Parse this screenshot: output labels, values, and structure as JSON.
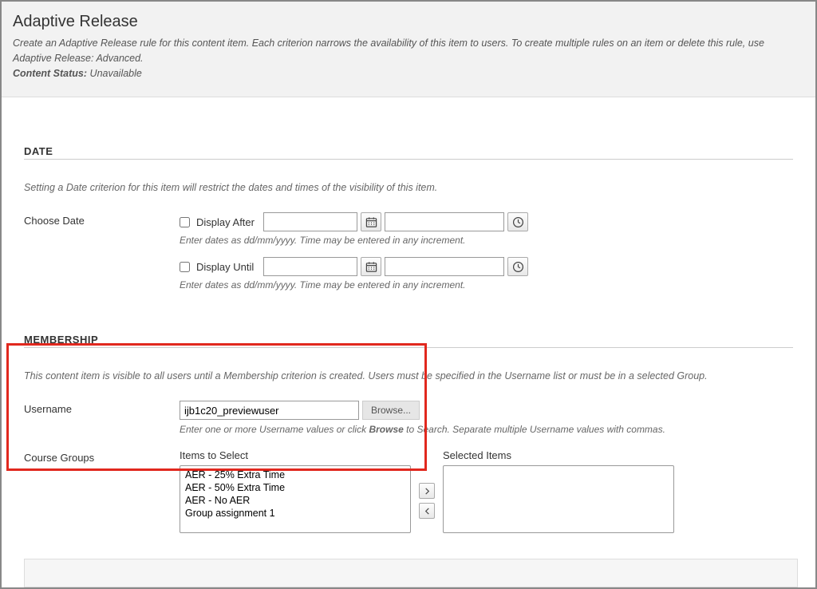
{
  "header": {
    "title": "Adaptive Release",
    "description": "Create an Adaptive Release rule for this content item. Each criterion narrows the availability of this item to users. To create multiple rules on an item or delete this rule, use Adaptive Release: Advanced.",
    "status_label": "Content Status:",
    "status_value": "Unavailable"
  },
  "date_section": {
    "heading": "DATE",
    "help": "Setting a Date criterion for this item will restrict the dates and times of the visibility of this item.",
    "label": "Choose Date",
    "after_label": "Display After",
    "until_label": "Display Until",
    "after_date": "",
    "after_time": "",
    "until_date": "",
    "until_time": "",
    "enter_hint": "Enter dates as dd/mm/yyyy. Time may be entered in any increment."
  },
  "membership_section": {
    "heading": "MEMBERSHIP",
    "help": "This content item is visible to all users until a Membership criterion is created. Users must be specified in the Username list or must be in a selected Group.",
    "username_label": "Username",
    "username_value": "ijb1c20_previewuser",
    "browse_label": "Browse...",
    "username_hint_pre": "Enter one or more Username values or click ",
    "username_hint_bold": "Browse",
    "username_hint_post": " to Search. Separate multiple Username values with commas.",
    "groups_label": "Course Groups",
    "items_to_select_label": "Items to Select",
    "selected_items_label": "Selected Items",
    "available_groups": [
      "AER - 25% Extra Time",
      "AER - 50% Extra Time",
      "AER - No AER",
      "Group assignment 1"
    ],
    "selected_groups": []
  }
}
